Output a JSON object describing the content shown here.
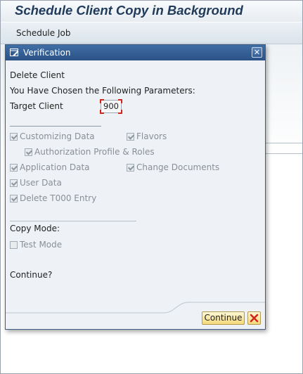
{
  "app": {
    "title": "Schedule Client Copy in Background",
    "toolbar": {
      "schedule_job": "Schedule Job"
    }
  },
  "dialog": {
    "title": "Verification",
    "title_icon": "edit-window-icon",
    "close_icon": "close-icon",
    "heading": "Delete Client",
    "params_intro": "You Have Chosen the Following Parameters:",
    "target_client_label": "Target Client",
    "target_client_value": "900",
    "options": [
      {
        "label": "Customizing Data",
        "checked": true
      },
      {
        "label": "Flavors",
        "checked": true
      },
      {
        "label": "Authorization Profile & Roles",
        "checked": true
      },
      {
        "label": "Application Data",
        "checked": true
      },
      {
        "label": "Change Documents",
        "checked": true
      },
      {
        "label": "User Data",
        "checked": true
      },
      {
        "label": "Delete T000 Entry",
        "checked": true
      }
    ],
    "copy_mode_label": "Copy Mode:",
    "test_mode": {
      "label": "Test Mode",
      "checked": false
    },
    "continue_question": "Continue?",
    "buttons": {
      "continue": "Continue",
      "cancel_icon": "cancel-x-icon"
    }
  },
  "colors": {
    "dialog_title_bg": "#2b5285",
    "app_title": "#1f3a5a",
    "button_bg": "#f4d97a",
    "cancel_red": "#d0261c",
    "focus_red": "#d0261c"
  }
}
